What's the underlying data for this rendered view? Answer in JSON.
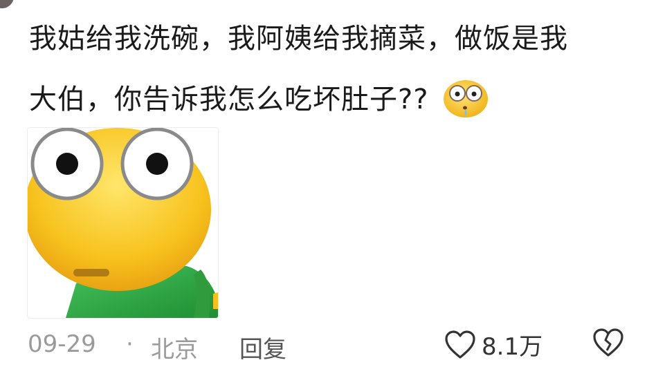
{
  "comment": {
    "line1": "我姑给我洗碗，我阿姨给我摘菜，做饭是我",
    "line2": "大伯，你告诉我怎么吃坏肚子??",
    "inline_emoji": "flushed-face-with-drool-emoji"
  },
  "sticker": {
    "icon": "bug-eyed-yellow-face-sticker",
    "face_color": "#f5c21b",
    "body_color": "#2aa63f"
  },
  "meta": {
    "date": "09-29",
    "separator": "·",
    "location": "北京",
    "reply_label": "回复",
    "like_icon": "heart-outline-icon",
    "like_count": "8.1万",
    "dislike_icon": "broken-heart-icon"
  }
}
